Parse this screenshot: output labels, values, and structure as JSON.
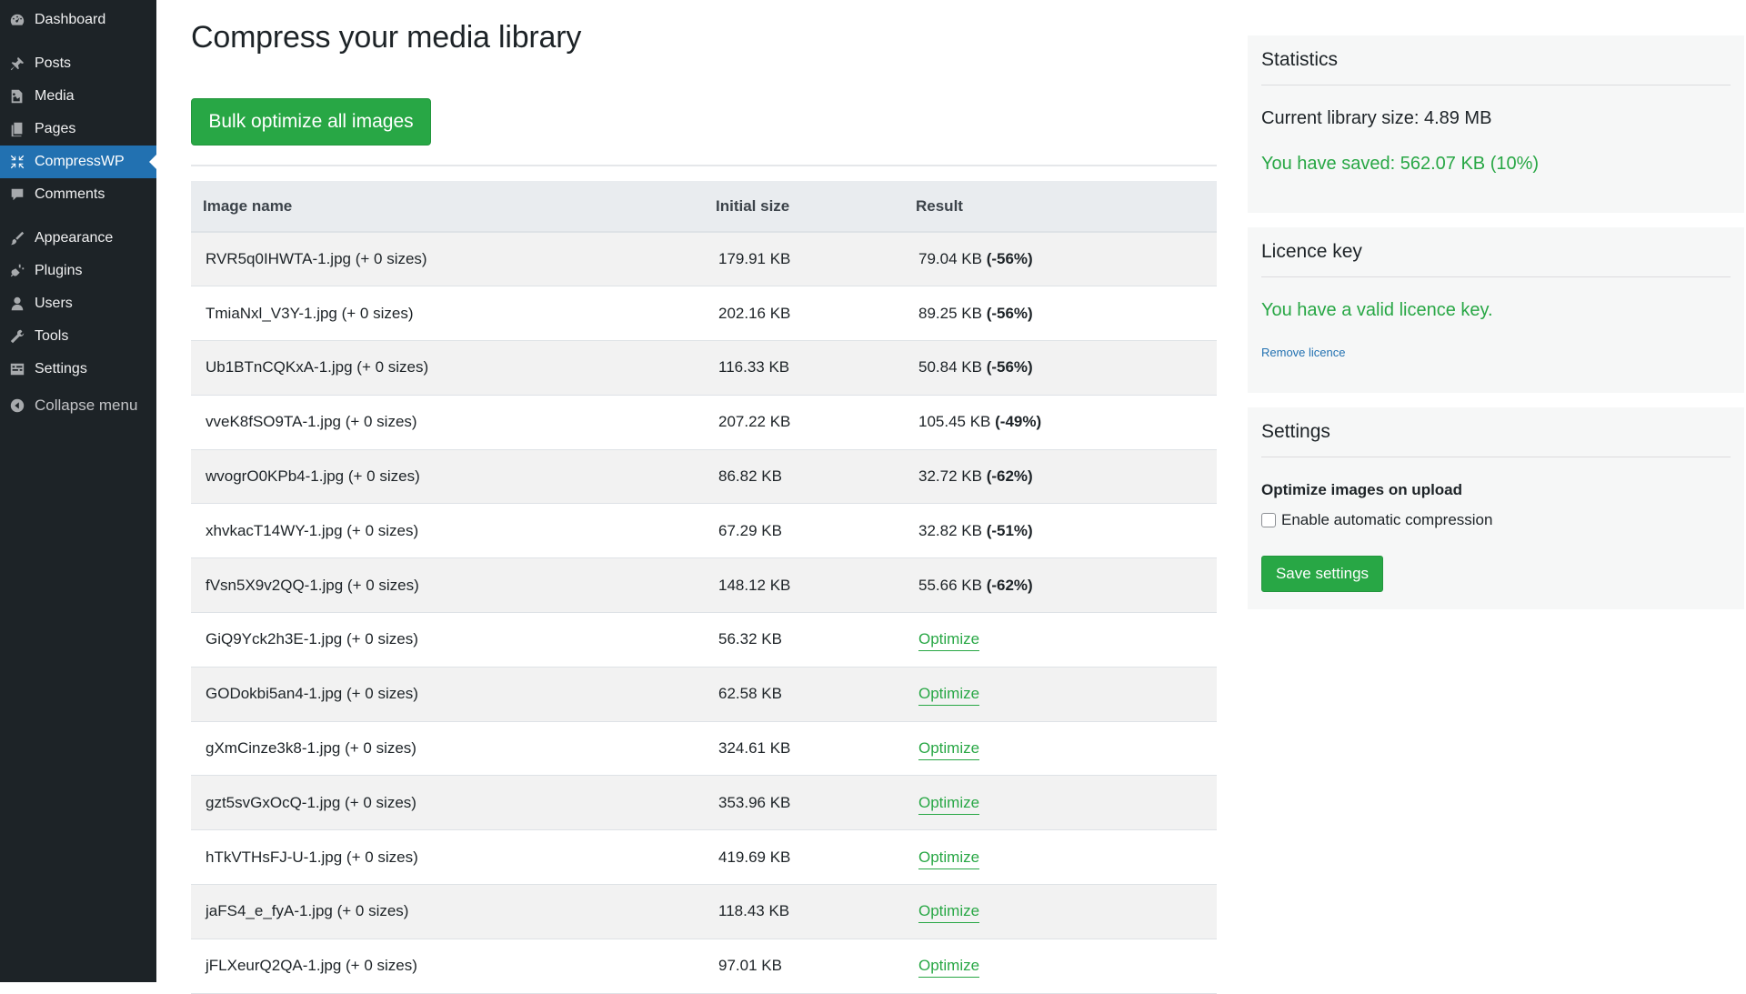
{
  "sidebar": {
    "items": [
      {
        "label": "Dashboard",
        "icon": "dashboard-icon"
      },
      {
        "label": "Posts",
        "icon": "pin-icon"
      },
      {
        "label": "Media",
        "icon": "media-icon"
      },
      {
        "label": "Pages",
        "icon": "pages-icon"
      },
      {
        "label": "CompressWP",
        "icon": "compress-icon",
        "active": true
      },
      {
        "label": "Comments",
        "icon": "comment-icon"
      },
      {
        "label": "Appearance",
        "icon": "brush-icon"
      },
      {
        "label": "Plugins",
        "icon": "plugin-icon"
      },
      {
        "label": "Users",
        "icon": "user-icon"
      },
      {
        "label": "Tools",
        "icon": "wrench-icon"
      },
      {
        "label": "Settings",
        "icon": "settings-icon"
      }
    ],
    "collapse_label": "Collapse menu"
  },
  "main": {
    "title": "Compress your media library",
    "bulk_button": "Bulk optimize all images",
    "table": {
      "headers": [
        "Image name",
        "Initial size",
        "Result"
      ],
      "rows": [
        {
          "name": "RVR5q0IHWTA-1.jpg (+ 0 sizes)",
          "initial": "179.91 KB",
          "result": "79.04 KB",
          "pct": "(-56%)"
        },
        {
          "name": "TmiaNxl_V3Y-1.jpg (+ 0 sizes)",
          "initial": "202.16 KB",
          "result": "89.25 KB",
          "pct": "(-56%)"
        },
        {
          "name": "Ub1BTnCQKxA-1.jpg (+ 0 sizes)",
          "initial": "116.33 KB",
          "result": "50.84 KB",
          "pct": "(-56%)"
        },
        {
          "name": "vveK8fSO9TA-1.jpg (+ 0 sizes)",
          "initial": "207.22 KB",
          "result": "105.45 KB",
          "pct": "(-49%)"
        },
        {
          "name": "wvogrO0KPb4-1.jpg (+ 0 sizes)",
          "initial": "86.82 KB",
          "result": "32.72 KB",
          "pct": "(-62%)"
        },
        {
          "name": "xhvkacT14WY-1.jpg (+ 0 sizes)",
          "initial": "67.29 KB",
          "result": "32.82 KB",
          "pct": "(-51%)"
        },
        {
          "name": "fVsn5X9v2QQ-1.jpg (+ 0 sizes)",
          "initial": "148.12 KB",
          "result": "55.66 KB",
          "pct": "(-62%)"
        },
        {
          "name": "GiQ9Yck2h3E-1.jpg (+ 0 sizes)",
          "initial": "56.32 KB",
          "action": "Optimize"
        },
        {
          "name": "GODokbi5an4-1.jpg (+ 0 sizes)",
          "initial": "62.58 KB",
          "action": "Optimize"
        },
        {
          "name": "gXmCinze3k8-1.jpg (+ 0 sizes)",
          "initial": "324.61 KB",
          "action": "Optimize"
        },
        {
          "name": "gzt5svGxOcQ-1.jpg (+ 0 sizes)",
          "initial": "353.96 KB",
          "action": "Optimize"
        },
        {
          "name": "hTkVTHsFJ-U-1.jpg (+ 0 sizes)",
          "initial": "419.69 KB",
          "action": "Optimize"
        },
        {
          "name": "jaFS4_e_fyA-1.jpg (+ 0 sizes)",
          "initial": "118.43 KB",
          "action": "Optimize"
        },
        {
          "name": "jFLXeurQ2QA-1.jpg (+ 0 sizes)",
          "initial": "97.01 KB",
          "action": "Optimize"
        }
      ]
    }
  },
  "statistics": {
    "title": "Statistics",
    "library_label": "Current library size:",
    "library_value": "4.89 MB",
    "saved_label": "You have saved:",
    "saved_value": "562.07 KB (10%)"
  },
  "licence": {
    "title": "Licence key",
    "status": "You have a valid licence key.",
    "remove_link": "Remove licence"
  },
  "settings": {
    "title": "Settings",
    "option_label": "Optimize images on upload",
    "checkbox_label": "Enable automatic compression",
    "checkbox_checked": false,
    "save_button": "Save settings"
  },
  "colors": {
    "accent_green": "#28a745",
    "sidebar_bg": "#1d2327",
    "active_blue": "#2271b1",
    "link_blue": "#2271b1"
  }
}
